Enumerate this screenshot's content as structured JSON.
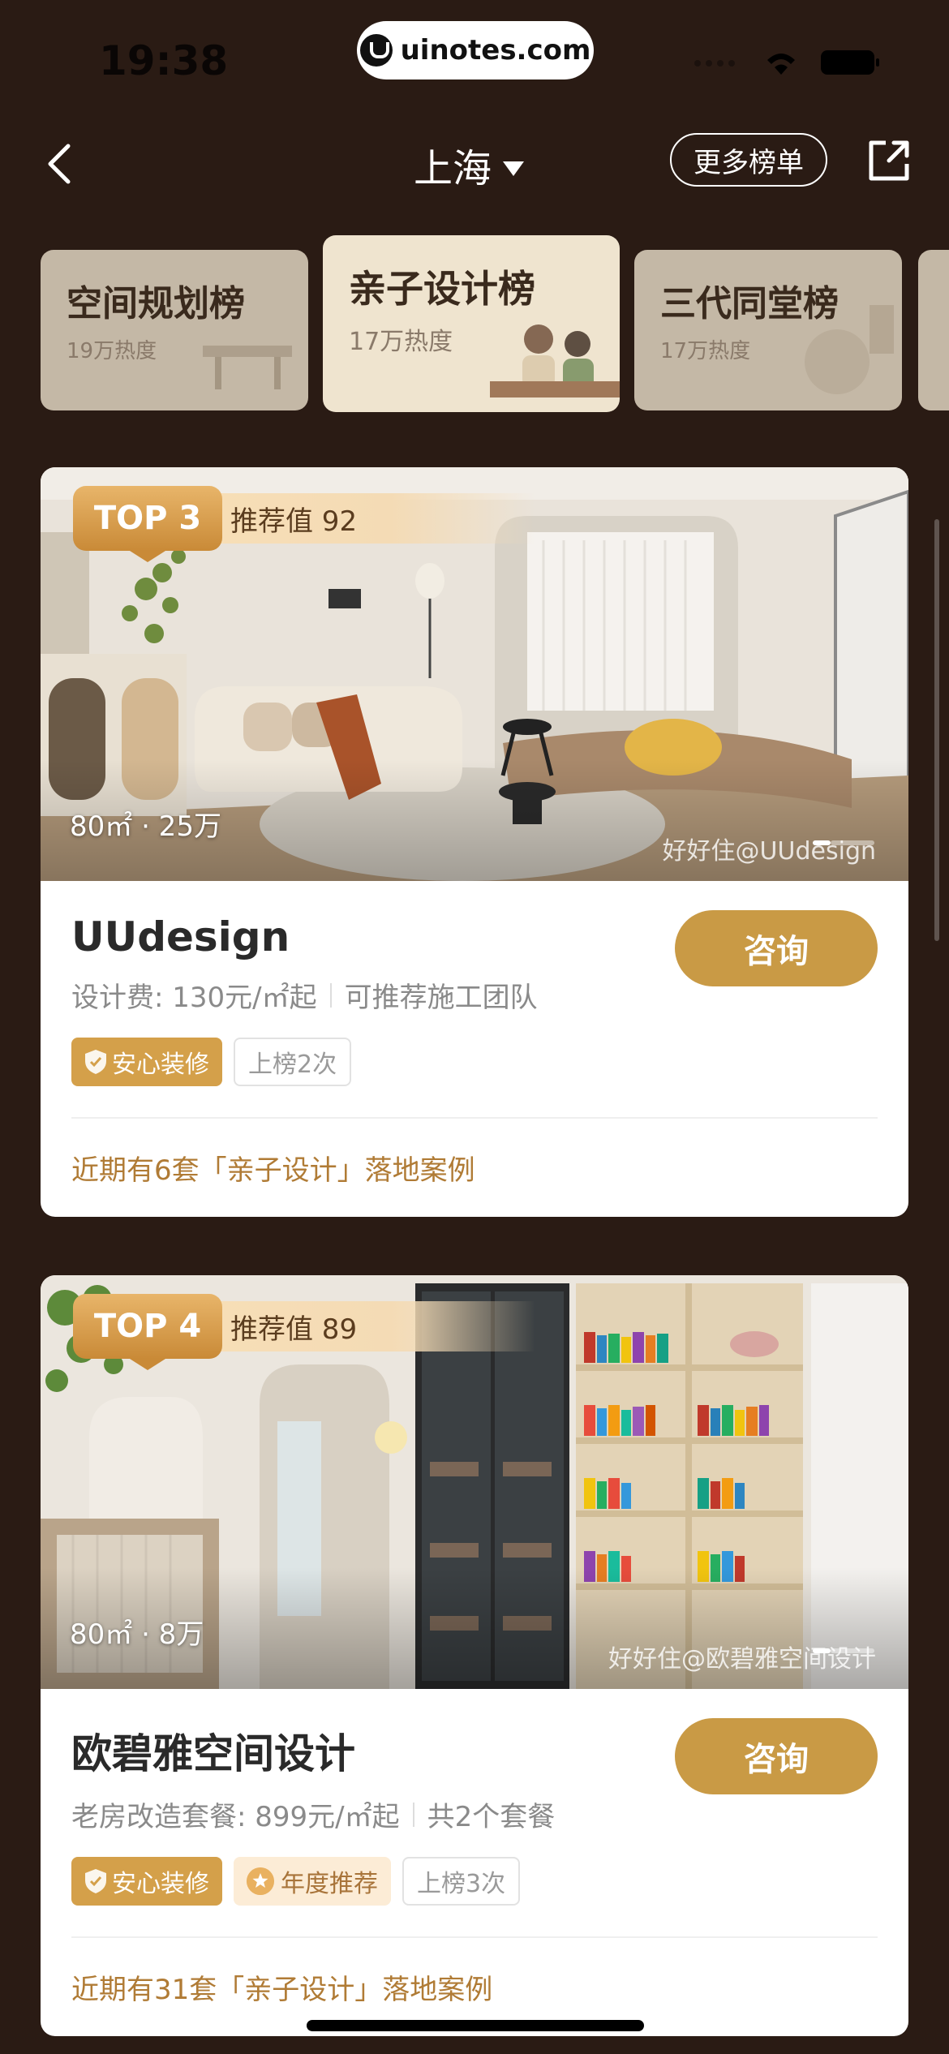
{
  "status_bar": {
    "time": "19:38",
    "url": "uinotes.com"
  },
  "nav": {
    "city": "上海",
    "more_button": "更多榜单"
  },
  "tabs": [
    {
      "title": "空间规划榜",
      "sub": "19万热度"
    },
    {
      "title": "亲子设计榜",
      "sub": "17万热度",
      "active": true
    },
    {
      "title": "三代同堂榜",
      "sub": "17万热度"
    }
  ],
  "cards": [
    {
      "rank": "TOP 3",
      "score": "推荐值 92",
      "area": "80㎡ · 25万",
      "watermark": "好好住@UUdesign",
      "name": "UUdesign",
      "consult": "咨询",
      "fee": "设计费: 130元/㎡起",
      "extra": "可推荐施工团队",
      "tags": [
        "安心装修",
        "上榜2次"
      ],
      "cases": "近期有6套「亲子设计」落地案例"
    },
    {
      "rank": "TOP 4",
      "score": "推荐值 89",
      "area": "80㎡ · 8万",
      "watermark": "好好住@欧碧雅空间设计",
      "name": "欧碧雅空间设计",
      "consult": "咨询",
      "fee": "老房改造套餐:  899元/㎡起",
      "extra": "共2个套餐",
      "tags": [
        "安心装修",
        "年度推荐",
        "上榜3次"
      ],
      "cases": "近期有31套「亲子设计」落地案例"
    }
  ]
}
